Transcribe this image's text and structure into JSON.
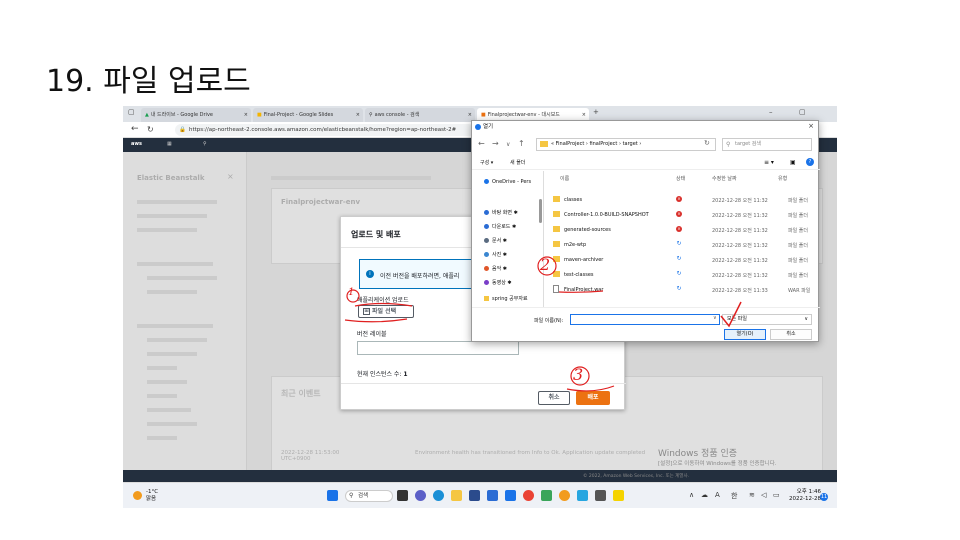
{
  "slide": {
    "title": "19. 파일 업로드"
  },
  "browser": {
    "tabs": [
      {
        "label": "내 드라이브 - Google Drive",
        "active": false
      },
      {
        "label": "Final-Project - Google Slides",
        "active": false
      },
      {
        "label": "aws console - 검색",
        "active": false
      },
      {
        "label": "Finalprojectwar-env - 대시보드",
        "active": true
      }
    ],
    "new_tab": "+",
    "url": "https://ap-northeast-2.console.aws.amazon.com/elasticbeanstalk/home?region=ap-northeast-2#"
  },
  "aws": {
    "sidebar_title": "Elastic Beanstalk",
    "env_name": "Finalprojectwar-env",
    "recent_events": "최근 이벤트",
    "event_date": "2022-12-28 11:53:00 UTC+0900",
    "event_text": "Environment health has transitioned from Info to Ok. Application update completed",
    "footer": "© 2022, Amazon Web Services, Inc. 또는 계열사."
  },
  "modal": {
    "title": "업로드 및 배포",
    "info_text": "이전 버전을 배포하려면, 애플리",
    "upload_label": "애플리케이션 업로드",
    "file_button": "파일 선택",
    "version_label": "버전 레이블",
    "instances_label": "현재 인스턴스 수:",
    "instances_count": "1",
    "cancel": "취소",
    "deploy": "배포"
  },
  "dialog": {
    "title": "열기",
    "path": [
      "FinalProject",
      "finalProject",
      "target"
    ],
    "search_placeholder": "target 검색",
    "toolbar": {
      "organize": "구성 ▾",
      "new_folder": "새 폴더"
    },
    "nav_items": [
      {
        "label": "OneDrive - Pers",
        "color": "#1a73e8"
      },
      {
        "label": "바탕 화면",
        "color": "#2b6cd4"
      },
      {
        "label": "다운로드",
        "color": "#2b6cd4"
      },
      {
        "label": "문서",
        "color": "#5a6b80"
      },
      {
        "label": "사진",
        "color": "#3a86d0"
      },
      {
        "label": "음악",
        "color": "#e0562a"
      },
      {
        "label": "동영상",
        "color": "#7a3ec8"
      },
      {
        "label": "spring 공부자료",
        "color": "#f5c642"
      }
    ],
    "columns": {
      "name": "이름",
      "status": "상태",
      "date": "수정한 날짜",
      "type": "유형"
    },
    "files": [
      {
        "name": "classes",
        "status": "err",
        "date": "2022-12-28 오전 11:32",
        "type": "파일 폴더",
        "kind": "folder"
      },
      {
        "name": "Controller-1.0.0-BUILD-SNAPSHOT",
        "status": "err",
        "date": "2022-12-28 오전 11:32",
        "type": "파일 폴더",
        "kind": "folder"
      },
      {
        "name": "generated-sources",
        "status": "err",
        "date": "2022-12-28 오전 11:32",
        "type": "파일 폴더",
        "kind": "folder"
      },
      {
        "name": "m2e-wtp",
        "status": "sync",
        "date": "2022-12-28 오전 11:32",
        "type": "파일 폴더",
        "kind": "folder"
      },
      {
        "name": "maven-archiver",
        "status": "sync",
        "date": "2022-12-28 오전 11:32",
        "type": "파일 폴더",
        "kind": "folder"
      },
      {
        "name": "test-classes",
        "status": "sync",
        "date": "2022-12-28 오전 11:32",
        "type": "파일 폴더",
        "kind": "folder"
      },
      {
        "name": "FinalProject.war",
        "status": "sync",
        "date": "2022-12-28 오전 11:33",
        "type": "WAR 파일",
        "kind": "file"
      }
    ],
    "filename_label": "파일 이름(N):",
    "filetype": "모든 파일",
    "open": "열기(O)",
    "cancel": "취소"
  },
  "windows": {
    "activation_title": "Windows 정품 인증",
    "activation_text": "[설정]으로 이동하여 Windows를 정품 인증합니다.",
    "weather_temp": "-1°C",
    "weather_desc": "맑음",
    "search": "검색",
    "ime": "한",
    "time": "오후 1:46",
    "date": "2022-12-28",
    "notifications": "11"
  },
  "annotations": {
    "n1": "1",
    "n2": "2",
    "n3": "3",
    "color": "#e02020"
  }
}
